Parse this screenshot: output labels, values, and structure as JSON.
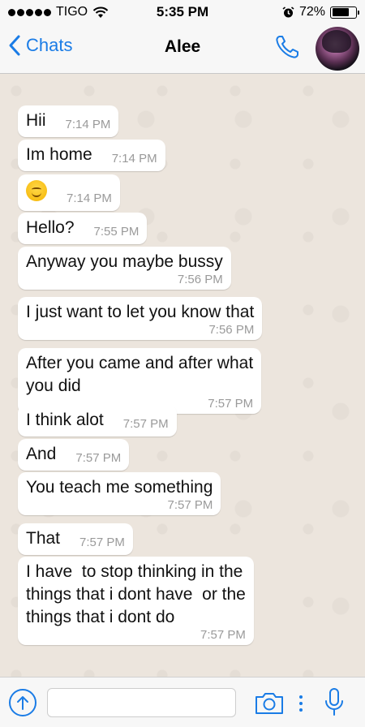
{
  "status": {
    "carrier": "TIGO",
    "time": "5:35 PM",
    "battery": "72%",
    "battery_level": 0.72
  },
  "header": {
    "back_label": "Chats",
    "contact_name": "Alee"
  },
  "messages": [
    {
      "text": "Hii",
      "time": "7:14 PM"
    },
    {
      "text": "Im home",
      "time": "7:14 PM"
    },
    {
      "text": "",
      "time": "7:14 PM",
      "emoji": "smiling-face"
    },
    {
      "text": "Hello?",
      "time": "7:55 PM"
    },
    {
      "text": "Anyway you maybe bussy",
      "time": "7:56 PM"
    },
    {
      "text": "I just want to let you know that",
      "time": "7:56 PM"
    },
    {
      "text": "After you came and after what\nyou did",
      "time": "7:57 PM"
    },
    {
      "text": "I think alot",
      "time": "7:57 PM"
    },
    {
      "text": "And",
      "time": "7:57 PM"
    },
    {
      "text": "You teach me something",
      "time": "7:57 PM"
    },
    {
      "text": "That",
      "time": "7:57 PM"
    },
    {
      "text": "I have  to stop thinking in the\nthings that i dont have  or the\nthings that i dont do",
      "time": "7:57 PM"
    }
  ],
  "input": {
    "placeholder": "",
    "value": ""
  },
  "icons": {
    "back": "chevron-left-icon",
    "call": "phone-icon",
    "share": "upload-icon",
    "camera": "camera-icon",
    "more": "more-icon",
    "mic": "microphone-icon"
  },
  "colors": {
    "accent": "#1a7ce6",
    "bubble": "#ffffff",
    "background": "#ece5dd"
  }
}
